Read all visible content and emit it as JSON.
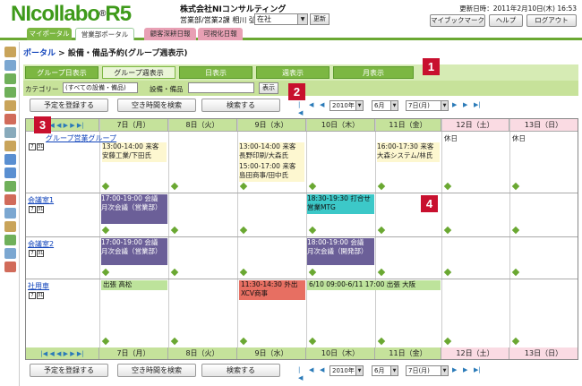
{
  "header": {
    "logo_main": "NIcollabo",
    "logo_reg": "®",
    "logo_ver": "R5",
    "company": "株式会社NIコンサルティング",
    "user": "営業部/営業2課 相川 弘 さん",
    "location": "在社",
    "refresh_label": "更新",
    "updated": "更新日時：2011年2月10日(木) 16:53",
    "buttons": [
      "マイブックマーク",
      "ヘルプ",
      "ログアウト"
    ]
  },
  "tabs": [
    "マイポータル",
    "営業部ポータル",
    "顧客深耕日報",
    "可視化日報"
  ],
  "breadcrumb": {
    "portal": "ポータル",
    "sep": " > ",
    "page": "設備・備品予約(グループ週表示)"
  },
  "views": [
    "グループ日表示",
    "グループ週表示",
    "日表示",
    "週表示",
    "月表示"
  ],
  "filter": {
    "category_label": "カテゴリー",
    "category_value": "(すべての設備・備品)",
    "item_label": "設備・備品",
    "show_label": "表示"
  },
  "actions": {
    "register": "予定を登録する",
    "search_free": "空き時間を検索",
    "search": "検索する"
  },
  "date_nav": {
    "year": "2010年",
    "month": "6月",
    "day": "7日(月)"
  },
  "days": [
    "7日（月）",
    "8日（火）",
    "9日（水）",
    "10日（木）",
    "11日（金）",
    "12日（土）",
    "13日（日）"
  ],
  "foot_days": [
    "7日（月）",
    "8日（火）",
    "9日（水）",
    "10日（木）",
    "11日（金）",
    "12日（土）",
    "13日（日）"
  ],
  "resources": [
    "グループ営業グループ",
    "会議室1",
    "会議室2",
    "社用車"
  ],
  "icon_labels": [
    "7",
    "31"
  ],
  "holiday": "休日",
  "events": {
    "r0d0": [
      "13:00-14:00 来客",
      "安藤工業/下田氏"
    ],
    "r0d2a": [
      "13:00-14:00 来客",
      "長野印刷/大森氏"
    ],
    "r0d2b": [
      "15:00-17:00 来客",
      "島田商事/田中氏"
    ],
    "r0d4": [
      "16:00-17:30 来客",
      "大森システム/林氏"
    ],
    "r1d0": [
      "17:00-19:00 会議",
      "月次会議（営業部）"
    ],
    "r1d3": [
      "18:30-19:30 打合せ",
      "営業MTG"
    ],
    "r2d0": [
      "17:00-19:00 会議",
      "月次会議（営業部）"
    ],
    "r2d3": [
      "18:00-19:00 会議",
      "月次会議（開発部）"
    ],
    "r3d0": "出張 高松",
    "r3d2": [
      "11:30-14:30 外出",
      "XCV商事"
    ],
    "r3d3": "6/10 09:00-6/11 17:00 出張 大阪"
  },
  "badges": [
    "1",
    "2",
    "3",
    "4"
  ],
  "colors": {
    "green": "#7cb742",
    "light_green": "#c5e29b",
    "purple": "#6b5f98",
    "cyan": "#3cc8c8",
    "red": "#e76f62",
    "pink": "#fadbe3",
    "badge": "#c8102e"
  }
}
